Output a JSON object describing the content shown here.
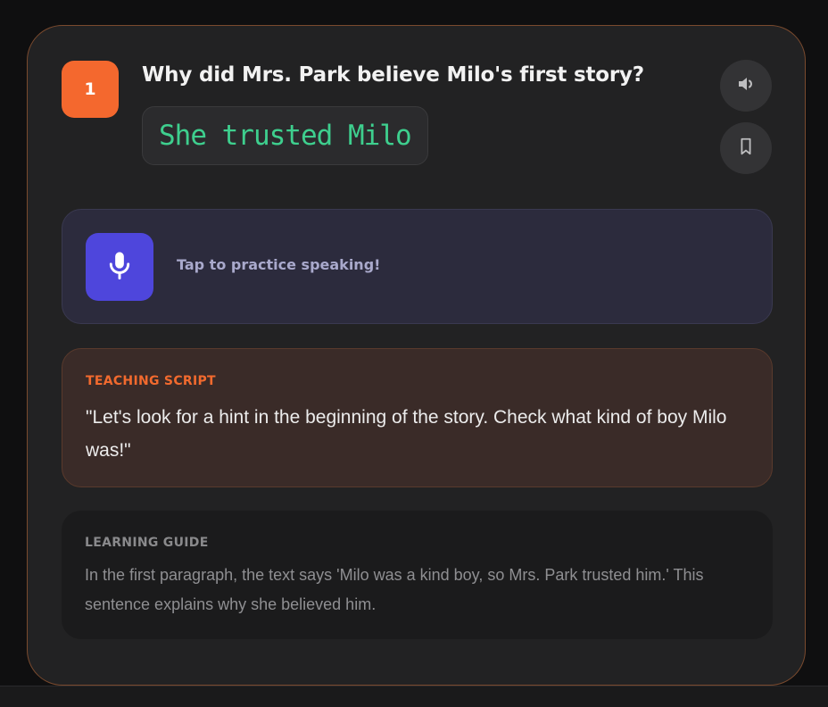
{
  "question": {
    "number": "1",
    "text": "Why did Mrs. Park believe Milo's first story?",
    "answer": "She trusted Milo"
  },
  "actions": {
    "speaker_icon": "speaker-icon",
    "bookmark_icon": "bookmark-icon"
  },
  "speaking": {
    "label": "Tap to practice speaking!",
    "icon": "microphone-icon"
  },
  "teaching_script": {
    "title": "TEACHING SCRIPT",
    "text": "\"Let's look for a hint in the beginning of the story. Check what kind of boy Milo was!\""
  },
  "learning_guide": {
    "title": "LEARNING GUIDE",
    "text": "In the first paragraph, the text says 'Milo was a kind boy, so Mrs. Park trusted him.' This sentence explains why she believed him."
  },
  "colors": {
    "accent": "#f4682e",
    "answer": "#3ecf8e",
    "mic": "#4e46dc"
  }
}
